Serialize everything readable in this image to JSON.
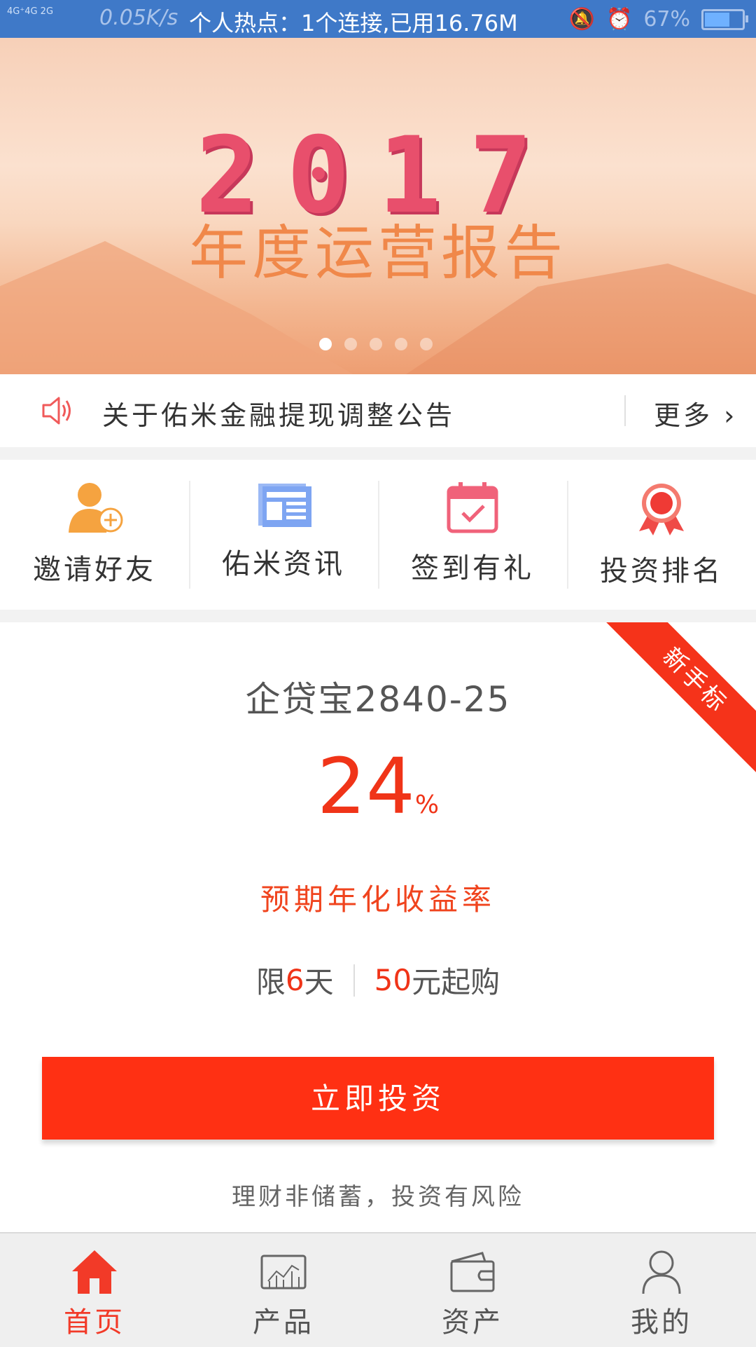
{
  "status_bar": {
    "signal_text": "4G⁺4G 2G",
    "speed": "0.05K/s",
    "hotspot": "个人热点：1个连接,已用16.76M",
    "battery": "67%",
    "battery_level": 0.67
  },
  "banner": {
    "year": "2017",
    "subtitle": "年度运营报告",
    "slide_count": 5,
    "active_slide": 1
  },
  "notice": {
    "text": "关于佑米金融提现调整公告",
    "more": "更多"
  },
  "quick_menu": [
    {
      "label": "邀请好友",
      "icon": "invite-friend-icon"
    },
    {
      "label": "佑米资讯",
      "icon": "news-icon"
    },
    {
      "label": "签到有礼",
      "icon": "calendar-check-icon"
    },
    {
      "label": "投资排名",
      "icon": "award-ribbon-icon"
    }
  ],
  "product": {
    "ribbon": "新手标",
    "name": "企贷宝2840-25",
    "rate_value": "24",
    "rate_unit": "%",
    "rate_label": "预期年化收益率",
    "term_prefix": "限",
    "term_value": "6",
    "term_suffix": "天",
    "min_value": "50",
    "min_suffix": "元起购",
    "button": "立即投资",
    "risk": "理财非储蓄，投资有风险"
  },
  "tab_bar": [
    {
      "label": "首页",
      "icon": "home-icon",
      "active": true
    },
    {
      "label": "产品",
      "icon": "chart-icon",
      "active": false
    },
    {
      "label": "资产",
      "icon": "wallet-icon",
      "active": false
    },
    {
      "label": "我的",
      "icon": "user-icon",
      "active": false
    }
  ],
  "colors": {
    "status_bar": "#3f79c8",
    "accent": "#ff3013",
    "invite_icon": "#f5a340",
    "news_icon": "#7ea5f2",
    "calendar_icon": "#f0627a",
    "award_icon": "#ef4a47"
  }
}
